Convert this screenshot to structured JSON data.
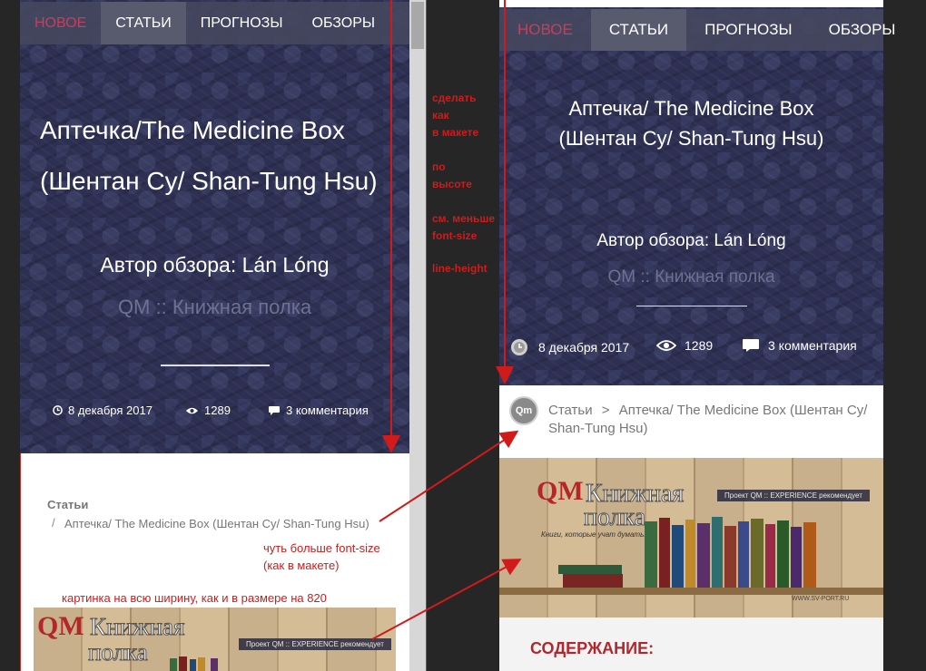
{
  "nav": {
    "items": [
      "НОВОЕ",
      "СТАТЬИ",
      "ПРОГНОЗЫ",
      "ОБЗОРЫ"
    ]
  },
  "article": {
    "title_line1": "Аптечка/The Medicine Box",
    "title_line2": "(Шентан Су/ Shan-Tung Hsu)",
    "right_title_line1": "Аптечка/ The Medicine Box",
    "right_title_line2": "(Шентан Су/ Shan-Tung Hsu)",
    "author": "Автор обзора: Lán Lóng",
    "right_author": "Автор обзора:  Lán Lóng",
    "source": "QM :: Книжная полка",
    "date": "8 декабря 2017",
    "views": "1289",
    "comments": "3 комментария"
  },
  "breadcrumb": {
    "root": "Статьи",
    "separator_left": "/",
    "separator_right": ">",
    "current_left": "Аптечка/ The Medicine Box (Шентан Су/ Shan-Tung Hsu)",
    "current_right": "Аптечка/ The Medicine Box (Шентан Су/ Shan-Tung Hsu)"
  },
  "banner": {
    "qm": "QM",
    "title_line1": "Книжная",
    "title_line2": "полка",
    "tagline": "Проект QM :: EXPERIENCE  рекомендует",
    "subtag": "Книги, которые учат думать...",
    "site": "WWW.SV-PORT.RU"
  },
  "content": {
    "section_heading": "СОДЕРЖАНИЕ:"
  },
  "logo": {
    "text": "Qm"
  },
  "annotations": {
    "make_like": [
      "сделать",
      "как",
      "в макете"
    ],
    "height": [
      "по",
      "высоте"
    ],
    "font": [
      "см. меньше",
      "font-size"
    ],
    "lineheight": "line-height",
    "bigger_font": [
      "чуть больше font-size",
      "(как в макете)"
    ],
    "fullwidth": "картинка на всю ширину, как и в размере на 820"
  },
  "colors": {
    "accent_red": "#c4405a",
    "annotation_red": "#d11a1a",
    "heading_red": "#b0282f",
    "hero_bg": "#2d3052"
  },
  "icons": {
    "date": "clock-icon",
    "views": "eye-icon",
    "comments": "comment-icon"
  }
}
